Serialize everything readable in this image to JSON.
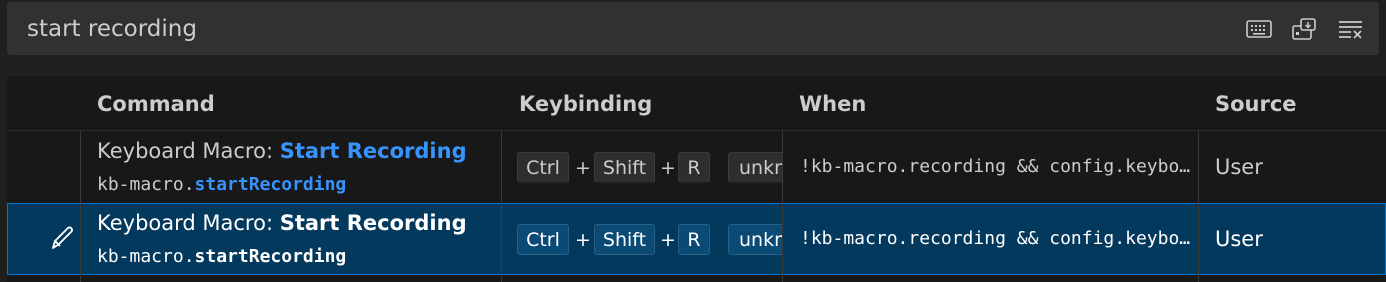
{
  "search": {
    "value": "start recording",
    "actions": [
      "keyboard-icon",
      "record-keys-icon",
      "clear-filter-icon"
    ]
  },
  "table": {
    "headers": {
      "command": "Command",
      "keybinding": "Keybinding",
      "when": "When",
      "source": "Source"
    },
    "rows": [
      {
        "title_prefix": "Keyboard Macro: ",
        "title_highlight": "Start Recording",
        "id_prefix": "kb-macro.",
        "id_highlight": "startRecording",
        "keys": [
          "Ctrl",
          "Shift",
          "R"
        ],
        "extra_key": "unknown",
        "when": "!kb-macro.recording && config.keyboardMacro.playbackInput == true",
        "source": "User"
      },
      {
        "title_prefix": "Keyboard Macro: ",
        "title_highlight": "Start Recording",
        "id_prefix": "kb-macro.",
        "id_highlight": "startRecording",
        "keys": [
          "Ctrl",
          "Shift",
          "R"
        ],
        "extra_key": "unknown",
        "when": "!kb-macro.recording && config.keyboardMacro.playbackInput == true",
        "source": "User"
      }
    ]
  },
  "colors": {
    "accent": "#3794ff",
    "selected_row": "#04395e",
    "focus_border": "#0078d4"
  }
}
